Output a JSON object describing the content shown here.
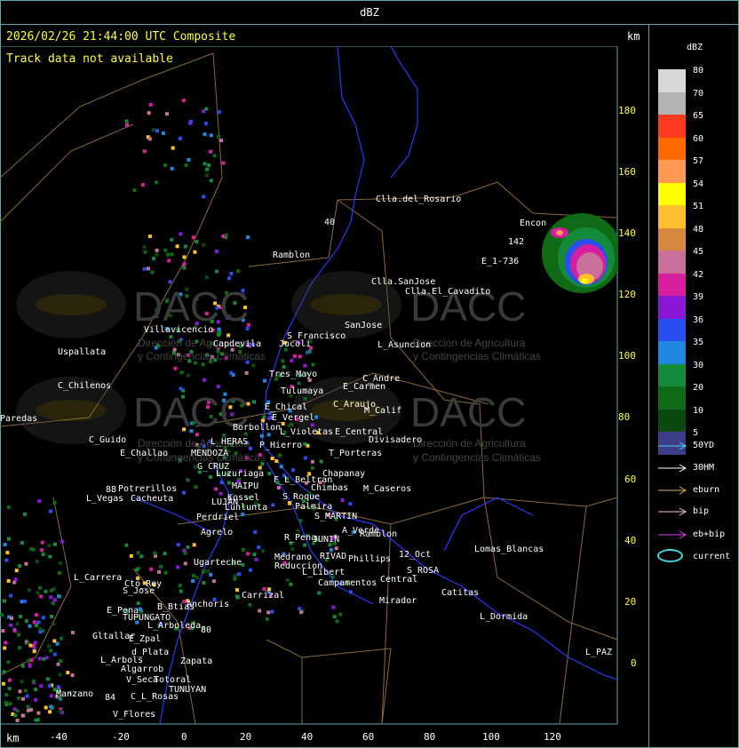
{
  "title": "dBZ",
  "map_header": {
    "timestamp": "2026/02/26 21:44:00 UTC Composite",
    "track_status": "Track data not available",
    "unit_top": "km",
    "unit_bottom": "km"
  },
  "y_ticks": [
    "180",
    "160",
    "140",
    "120",
    "100",
    "80",
    "60",
    "40",
    "20",
    "0"
  ],
  "x_ticks": [
    "-40",
    "-20",
    "0",
    "20",
    "40",
    "60",
    "80",
    "100",
    "120"
  ],
  "watermark": {
    "brand": "DACC",
    "line1": "Dirección de Agricultura",
    "line2": "y Contingencias Climáticas"
  },
  "places": [
    "Clla.del_Rosario",
    "Encon",
    "142",
    "E_1-736",
    "Ramblon",
    "Clla.SanJose",
    "Clla.El_Cavadito",
    "Villavicencio",
    "Capdevila",
    "S_Francisco",
    "SanJose",
    "L_Asuncion",
    "Uspallata",
    "Jocoli",
    "Tres_Mayo",
    "C_Andre",
    "C_Chilenos",
    "Tulumaya",
    "E_Carmen",
    "Paredas",
    "E_Chical",
    "C_Araujo",
    "M_Calif",
    "E_Vergel",
    "Borbollon",
    "L_Violetas",
    "E_Central",
    "Divisadero",
    "C_Guido",
    "L_HERAS",
    "P_Hierro",
    "E_Challao",
    "MENDOZA",
    "T_Porteras",
    "G_CRUZ",
    "Luzuriaga",
    "Chapanay",
    "MAIPU",
    "F_L_Beltran",
    "Chimbas",
    "M_Caseros",
    "Potrerillos",
    "Kossel",
    "L_Vegas",
    "Cacheuta",
    "LUJAN",
    "S_Roque",
    "Palmira",
    "Lunlunta",
    "Perdriel",
    "S_MARTIN",
    "A_Verde",
    "Ramblon",
    "Agrelo",
    "R_Pena",
    "JUNIN",
    "12_Oct",
    "Lomas_Blancas",
    "Ugarteche",
    "Medrano",
    "RIVAD",
    "Phillips",
    "S_ROSA",
    "L_Libert",
    "Reduccion",
    "L_Carrera",
    "Cto_Rey",
    "Central",
    "S_Jose",
    "Campamentos",
    "Catitas",
    "Carrizal",
    "B_Btias",
    "Anchoris",
    "Mirador",
    "E_Pena",
    "TUPUNGATO",
    "L_Dormida",
    "L_Arboleda",
    "Gltallar",
    "E_Zpal",
    "L_PAZ",
    "d_Plata",
    "L_Arbols",
    "Algarrob",
    "Zapata",
    "V_Seca",
    "Totoral",
    "TUNUYAN",
    "Manzano",
    "C_L_Rosas",
    "V_Flores",
    "88",
    "40",
    "84",
    "80"
  ],
  "legend": {
    "title": "dBZ",
    "scale": [
      {
        "label": "80",
        "color": "#d8d8d8"
      },
      {
        "label": "70",
        "color": "#b4b4b4"
      },
      {
        "label": "65",
        "color": "#ff3a1e"
      },
      {
        "label": "60",
        "color": "#ff6a00"
      },
      {
        "label": "57",
        "color": "#ff9a55"
      },
      {
        "label": "54",
        "color": "#ffff00"
      },
      {
        "label": "51",
        "color": "#ffc02e"
      },
      {
        "label": "48",
        "color": "#d8883e"
      },
      {
        "label": "45",
        "color": "#c8709a"
      },
      {
        "label": "42",
        "color": "#d81ea0"
      },
      {
        "label": "39",
        "color": "#8a17d6"
      },
      {
        "label": "36",
        "color": "#2a4ef0"
      },
      {
        "label": "35",
        "color": "#1e88e0"
      },
      {
        "label": "30",
        "color": "#148a3a"
      },
      {
        "label": "20",
        "color": "#0e6a14"
      },
      {
        "label": "10",
        "color": "#0a4a10"
      },
      {
        "label": "5",
        "color": "#3c3c8a"
      }
    ],
    "tracks": [
      {
        "label": "50YD",
        "color": "#40d8e0"
      },
      {
        "label": "30HM",
        "color": "#ffffff"
      },
      {
        "label": "eburn",
        "color": "#e0b060"
      },
      {
        "label": "bip",
        "color": "#ffc8c8"
      },
      {
        "label": "eb+bip",
        "color": "#e040e0"
      },
      {
        "label": "current",
        "color": "#40d8e0"
      }
    ]
  }
}
